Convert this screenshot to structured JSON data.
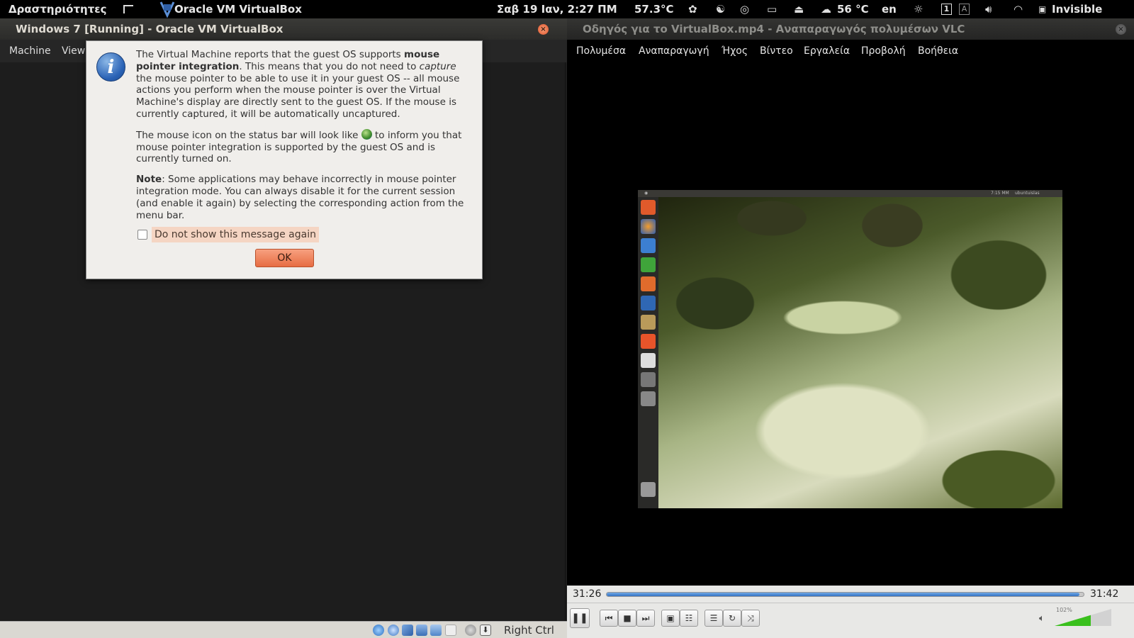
{
  "top_panel": {
    "activities": "Δραστηριότητες",
    "app_name": "Oracle VM VirtualBox",
    "datetime": "Σαβ 19 Ιαν,  2:27 ΠΜ",
    "cpu_temp": "57.3°C",
    "weather_temp": "56 °C",
    "keyboard": "en",
    "workspace_1": "1",
    "workspace_a": "A",
    "status": "Invisible"
  },
  "vbox": {
    "title": "Windows 7 [Running] - Oracle VM VirtualBox",
    "menu": {
      "machine": "Machine",
      "view": "View"
    },
    "status_host_key": "Right Ctrl"
  },
  "dialog": {
    "p1_a": "The Virtual Machine reports that the guest OS supports ",
    "p1_bold": "mouse pointer integration",
    "p1_b": ". This means that you do not need to ",
    "p1_ital": "capture",
    "p1_c": " the mouse pointer to be able to use it in your guest OS -- all mouse actions you perform when the mouse pointer is over the Virtual Machine's display are directly sent to the guest OS. If the mouse is currently captured, it will be automatically uncaptured.",
    "p2_a": "The mouse icon on the status bar will look like ",
    "p2_b": " to inform you that mouse pointer integration is supported by the guest OS and is currently turned on.",
    "p3_bold": "Note",
    "p3_a": ": Some applications may behave incorrectly in mouse pointer integration mode. You can always disable it for the current session (and enable it again) by selecting the corresponding action from the menu bar.",
    "checkbox_label": "Do not show this message again",
    "checkbox_checked": false,
    "ok_label": "OK"
  },
  "vlc": {
    "title": "Οδηγός για το VirtualBox.mp4 - Αναπαραγωγός πολυμέσων VLC",
    "menu": [
      "Πολυμέσα",
      "Αναπαραγωγή",
      "Ήχος",
      "Βίντεο",
      "Εργαλεία",
      "Προβολή",
      "Βοήθεια"
    ],
    "elapsed": "31:26",
    "total": "31:42",
    "progress": 0.991,
    "volume_label": "102%",
    "volume": 0.64,
    "video_topbar_time": "7:15 ΜΜ",
    "video_topbar_user": "ubuntuislas"
  },
  "colors": {
    "accent_orange": "#e76d43",
    "seek_blue": "#3573c2",
    "volume_green": "#3ac01d"
  }
}
